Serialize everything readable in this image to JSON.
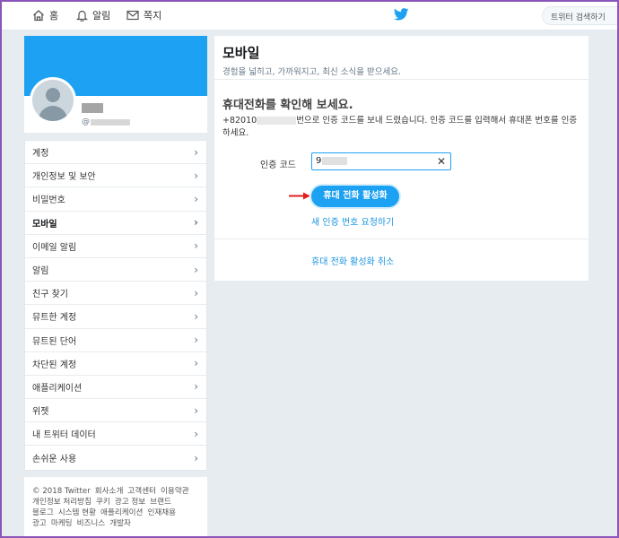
{
  "topnav": {
    "home_label": "홈",
    "notifications_label": "알림",
    "messages_label": "쪽지",
    "search_placeholder": "트위터 검색하기",
    "accent": "#1da1f2"
  },
  "profile": {
    "handle_prefix": "@"
  },
  "settings_nav": {
    "items": [
      {
        "label": "계정"
      },
      {
        "label": "개인정보 및 보안"
      },
      {
        "label": "비밀번호"
      },
      {
        "label": "모바일",
        "active": true
      },
      {
        "label": "이메일 알림"
      },
      {
        "label": "알림"
      },
      {
        "label": "친구 찾기"
      },
      {
        "label": "뮤트한 계정"
      },
      {
        "label": "뮤트된 단어"
      },
      {
        "label": "차단된 계정"
      },
      {
        "label": "애플리케이션"
      },
      {
        "label": "위젯"
      },
      {
        "label": "내 트위터 데이터"
      },
      {
        "label": "손쉬운 사용"
      }
    ]
  },
  "footer": {
    "rows": [
      [
        "© 2018 Twitter",
        "회사소개",
        "고객센터",
        "이용약관"
      ],
      [
        "개인정보 처리방침",
        "쿠키",
        "광고 정보",
        "브랜드"
      ],
      [
        "블로그",
        "시스템 현황",
        "애플리케이션",
        "인재채용"
      ],
      [
        "광고",
        "마케팅",
        "비즈니스",
        "개발자"
      ]
    ]
  },
  "main": {
    "title": "모바일",
    "subtitle": "경험을 넓히고, 가까워지고, 최신 소식을 받으세요.",
    "section_title": "휴대전화를 확인해 보세요.",
    "phone_prefix": "+82010",
    "desc_suffix": "번으로 인증 코드를 보내 드렸습니다. 인증 코드를 입력해서 휴대폰 번호를 인증하세요.",
    "code_label": "인증 코드",
    "code_value_prefix": "9",
    "activate_button": "휴대 전화 활성화",
    "resend_link": "새 인증 번호 요청하기",
    "cancel_link": "휴대 전화 활성화 취소"
  }
}
